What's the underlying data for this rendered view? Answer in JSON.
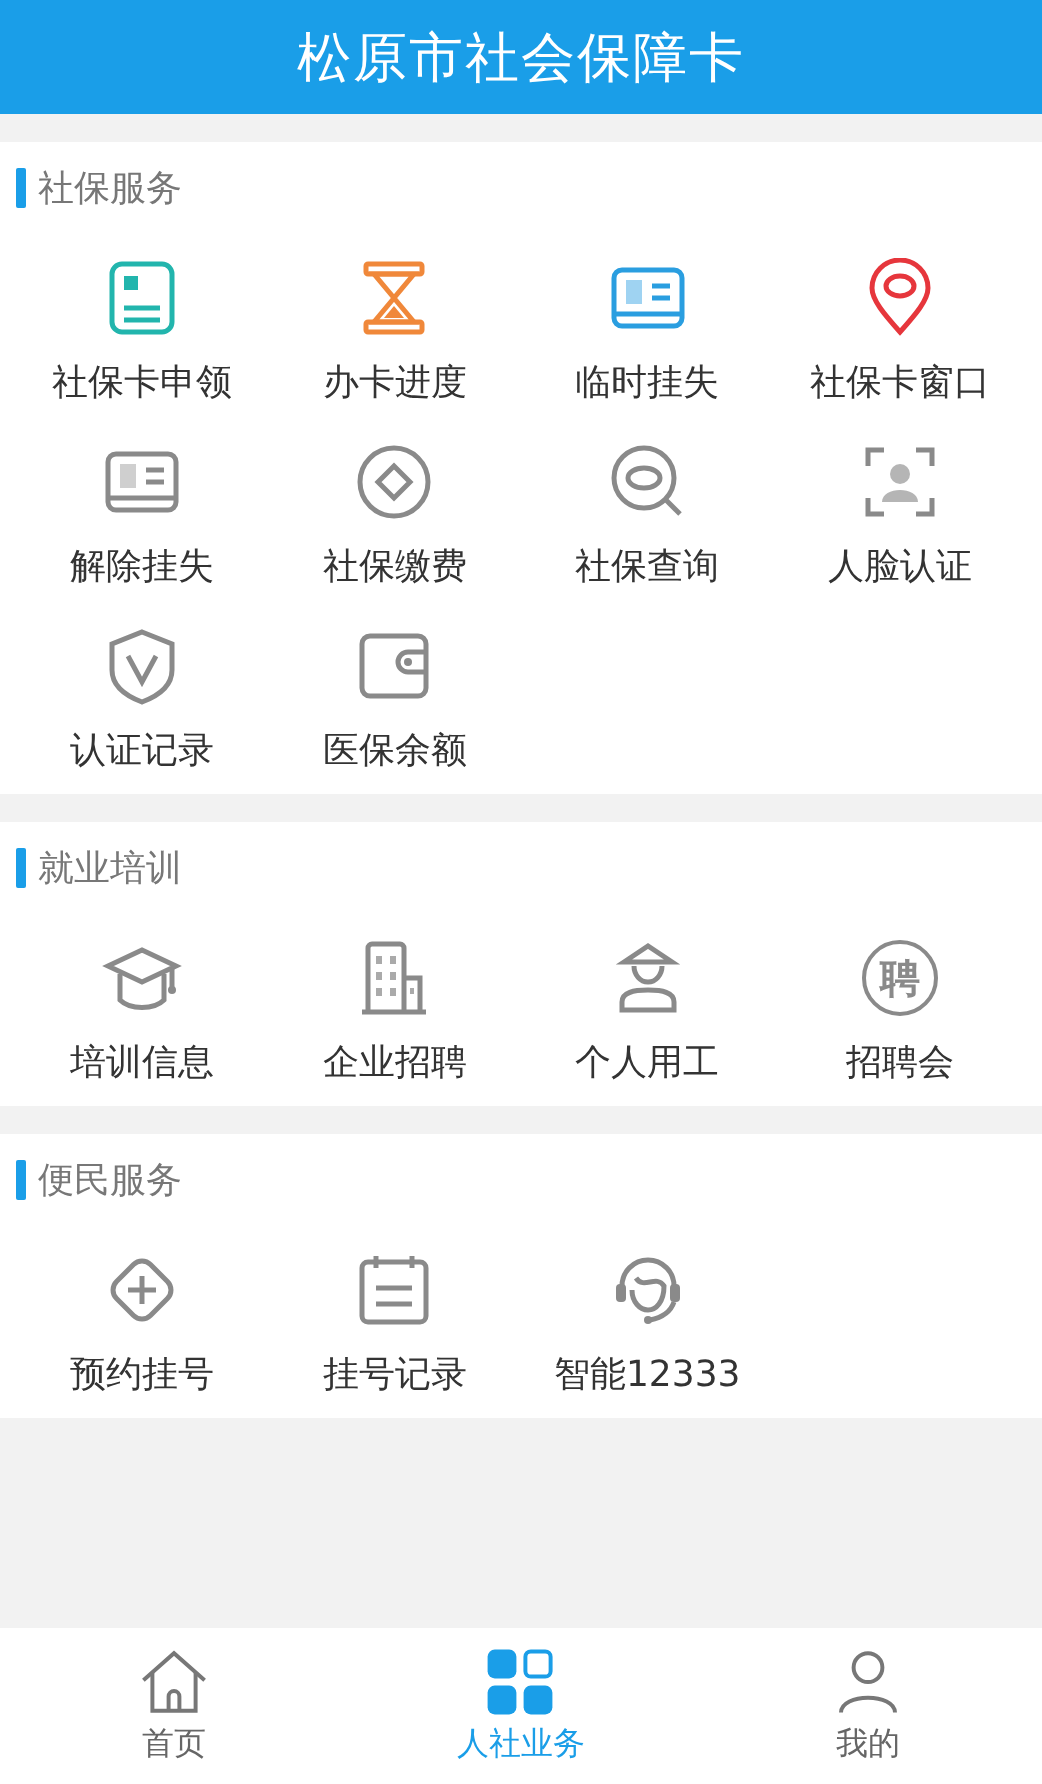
{
  "header": {
    "title": "松原市社会保障卡"
  },
  "sections": [
    {
      "title": "社保服务",
      "items": [
        {
          "label": "社保卡申领"
        },
        {
          "label": "办卡进度"
        },
        {
          "label": "临时挂失"
        },
        {
          "label": "社保卡窗口"
        },
        {
          "label": "解除挂失"
        },
        {
          "label": "社保缴费"
        },
        {
          "label": "社保查询"
        },
        {
          "label": "人脸认证"
        },
        {
          "label": "认证记录"
        },
        {
          "label": "医保余额"
        }
      ]
    },
    {
      "title": "就业培训",
      "items": [
        {
          "label": "培训信息"
        },
        {
          "label": "企业招聘"
        },
        {
          "label": "个人用工"
        },
        {
          "label": "招聘会",
          "icon_text": "聘"
        }
      ]
    },
    {
      "title": "便民服务",
      "items": [
        {
          "label": "预约挂号"
        },
        {
          "label": "挂号记录"
        },
        {
          "label": "智能12333"
        }
      ]
    }
  ],
  "tab_bar": [
    {
      "label": "首页",
      "selected": false
    },
    {
      "label": "人社业务",
      "selected": true
    },
    {
      "label": "我的",
      "selected": false
    }
  ]
}
